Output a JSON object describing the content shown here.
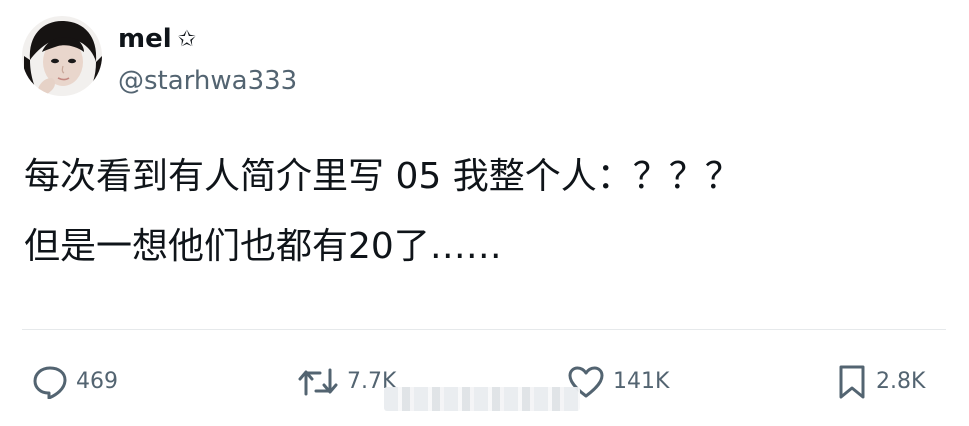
{
  "author": {
    "display_name": "mel",
    "badge_icon": "star-outline-icon",
    "badge_glyph": "✩",
    "handle": "@starhwa333"
  },
  "tweet": {
    "text_line_1": "每次看到有人简介里写 05 我整个人：？？？",
    "text_line_2": "但是一想他们也都有20了……"
  },
  "actions": {
    "reply": {
      "icon": "reply-icon",
      "count": "469"
    },
    "retweet": {
      "icon": "retweet-icon",
      "count": "7.7K"
    },
    "like": {
      "icon": "heart-icon",
      "count": "141K"
    },
    "bookmark": {
      "icon": "bookmark-icon",
      "count": "2.8K"
    }
  },
  "colors": {
    "text_primary": "#0f1419",
    "text_secondary": "#536471",
    "divider": "#e6e9eb",
    "background": "#ffffff"
  }
}
